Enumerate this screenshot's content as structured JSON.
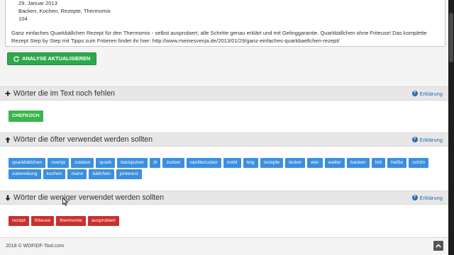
{
  "textbox": {
    "date": "29. Januar 2013",
    "categories": "Backen, Kochen, Rezepte, Thermomix",
    "count": "104",
    "description_line1": "Ganz einfaches Quarkbällchen Rezept für den Thermomix - selbst ausprobiert, alle Schritte genau erklärt und mit Gelinggarantie. Quarkbällchen ohne Friteuse! Das komplette",
    "description_line2": "Rezept Step by Step mit Tipps zum Fritieren findet ihr hier: http://www.meinesvenja.de/2013/01/29/ganz-einfaches-quarkbaellchen-rezept/"
  },
  "analyse_button": {
    "label": "ANALYSE AKTUALISIEREN",
    "icon": "refresh-icon",
    "color": "#2ea84e"
  },
  "help_label": "Erklärung",
  "sections": {
    "missing": {
      "title": "Wörter die im Text noch fehlen",
      "icon": "plus-icon",
      "tags": [
        "CHEFKOCH"
      ],
      "tag_color": "#3bb54a"
    },
    "more": {
      "title": "Wörter die öfter verwendet werden sollten",
      "icon": "arrow-up-icon",
      "tags": [
        "quarkbällchen",
        "svenja",
        "zutaten",
        "quark",
        "backpulver",
        "öl",
        "zucker",
        "vanillezucker",
        "mehl",
        "teig",
        "rezepte",
        "lecker",
        "eier",
        "walter",
        "backen",
        "fett",
        "heiße",
        "schön",
        "zubereitung",
        "kochen",
        "mann",
        "bällchen",
        "pinterest"
      ],
      "tag_color": "#3a8fe0"
    },
    "less": {
      "title": "Wörter die weniger verwendet werden sollten",
      "icon": "arrow-down-icon",
      "tags": [
        "rezept",
        "friteuse",
        "thermomix",
        "ausprobiert"
      ],
      "tag_color": "#c9302c"
    }
  },
  "footer": {
    "copyright": "2018 © WDFIDF-Tool.com",
    "to_top_icon": "chevron-up-icon"
  }
}
